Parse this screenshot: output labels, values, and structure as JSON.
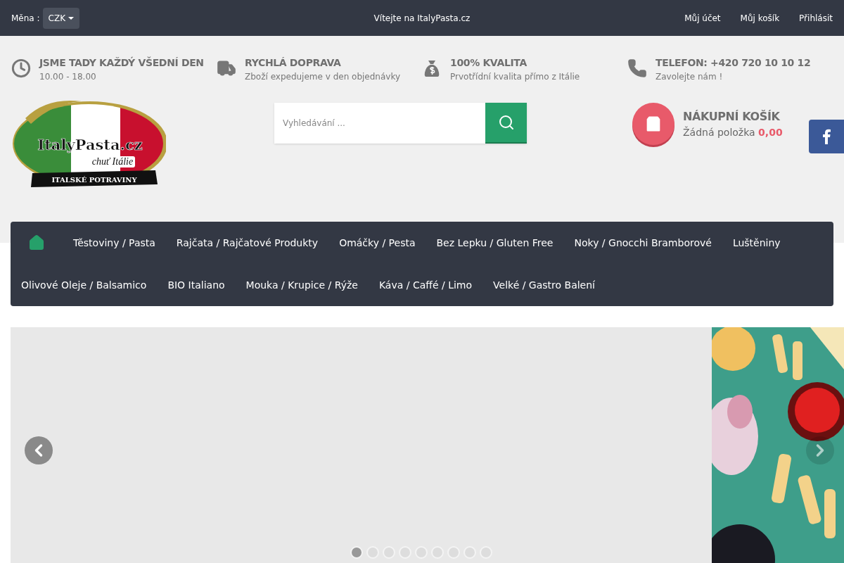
{
  "topbar": {
    "currency_label": "Měna :",
    "currency": "CZK",
    "welcome": "Vítejte na ItalyPasta.cz",
    "links": [
      "Můj účet",
      "Můj košík",
      "Přihlásit"
    ]
  },
  "features": [
    {
      "kind": "clock",
      "title": "JSME TADY KAŽDÝ VŠEDNÍ DEN",
      "subtitle": "10.00 - 18.00"
    },
    {
      "kind": "truck",
      "title": "RYCHLÁ DOPRAVA",
      "subtitle": "Zboží expedujeme v den objednávky"
    },
    {
      "kind": "money",
      "title": "100% KVALITA",
      "subtitle": "Prvotřídní kvalita přímo z Itálie"
    },
    {
      "kind": "phone",
      "title": "TELEFON: +420 720 10 10 12",
      "subtitle": "Zavolejte nám !"
    }
  ],
  "logo": {
    "name": "ItalyPasta.cz",
    "tagline": "chuť Itálie",
    "ribbon": "ITALSKÉ POTRAVINY"
  },
  "search": {
    "placeholder": "Vyhledávání ..."
  },
  "cart": {
    "title": "NÁKUPNÍ KOŠÍK",
    "status": "Žádná položka",
    "total": "0,00"
  },
  "nav": {
    "rows": [
      [
        "Těstoviny / Pasta",
        "Rajčata / Rajčatové Produkty",
        "Omáčky / Pesta",
        "Bez Lepku / Gluten Free",
        "Noky / Gnocchi Bramborové",
        "Luštěniny"
      ],
      [
        "Olivové Oleje / Balsamico",
        "BIO Italiano",
        "Mouka / Krupice / Rýže",
        "Káva / Caffé / Limo",
        "Velké / Gastro Balení"
      ]
    ]
  },
  "slider": {
    "dots": [
      {
        "selected": true
      },
      {
        "selected": false
      },
      {
        "selected": false
      },
      {
        "selected": false
      },
      {
        "selected": false
      },
      {
        "selected": false
      },
      {
        "selected": false
      },
      {
        "selected": false
      },
      {
        "selected": false
      }
    ]
  }
}
